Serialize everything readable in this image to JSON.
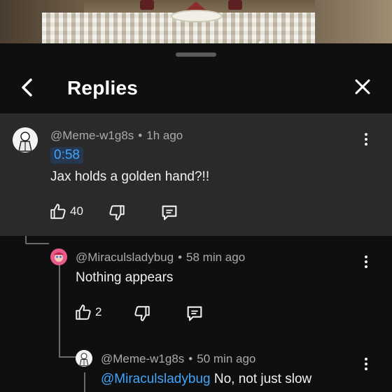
{
  "sheet": {
    "title": "Replies"
  },
  "top_comment": {
    "author": "@Meme-w1g8s",
    "age": "1h ago",
    "timestamp": "0:58",
    "text": "Jax holds a golden hand?!!",
    "likes": "40"
  },
  "replies": [
    {
      "author": "@Miraculsladybug",
      "age": "58 min ago",
      "text": "Nothing appears",
      "likes": "2"
    },
    {
      "author": "@Meme-w1g8s",
      "age": "50 min ago",
      "mention": "@Miraculsladybug",
      "text": "No, not just slow"
    }
  ],
  "separator": "•",
  "colors": {
    "background": "#0f0f0f",
    "highlight": "#2a2a2a",
    "link": "#3ea6ff",
    "meta": "#aaaaaa"
  },
  "icons": [
    "back-arrow-icon",
    "close-icon",
    "more-vert-icon",
    "thumbs-up-icon",
    "thumbs-down-icon",
    "reply-comment-icon",
    "avatar-icon"
  ]
}
